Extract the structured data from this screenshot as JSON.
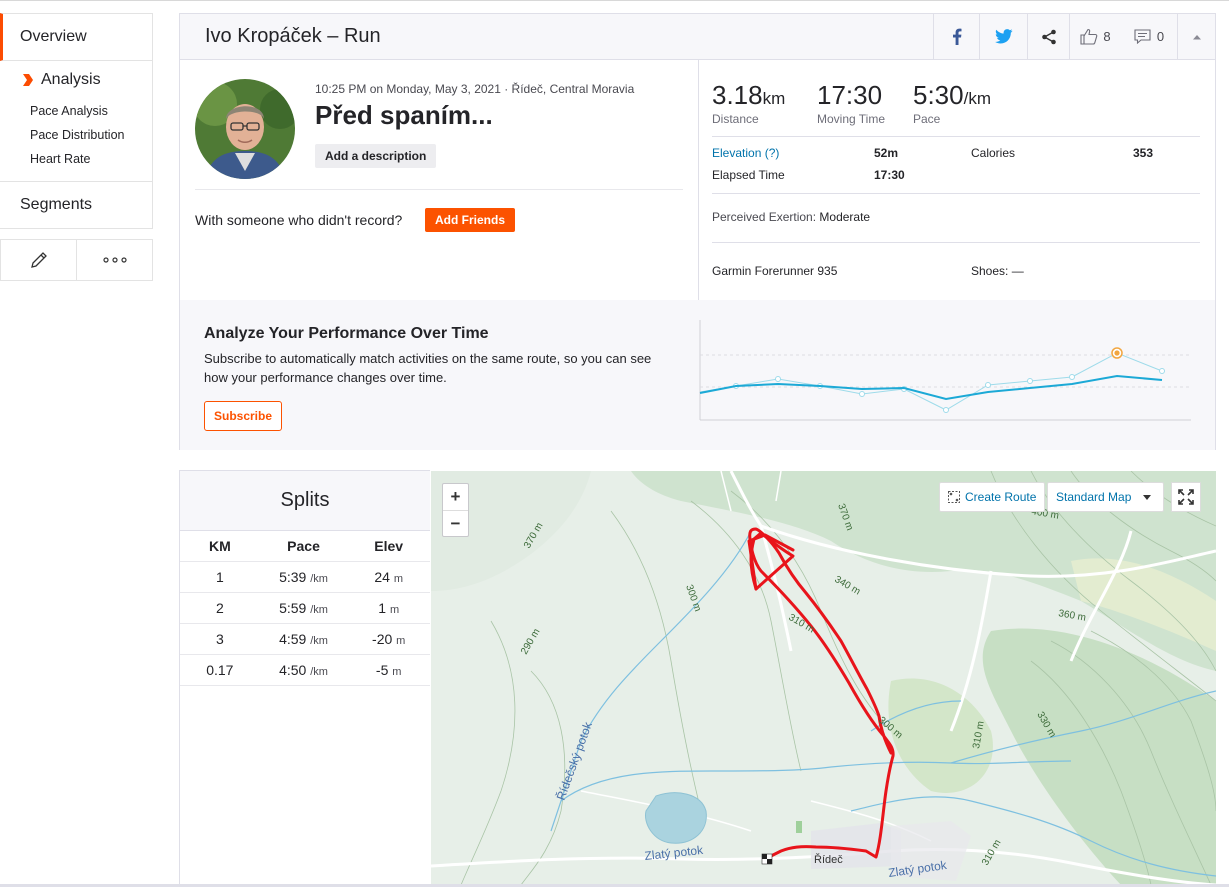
{
  "sidebar": {
    "overview": "Overview",
    "analysis": "Analysis",
    "analysis_items": [
      "Pace Analysis",
      "Pace Distribution",
      "Heart Rate"
    ],
    "segments": "Segments",
    "tools": [
      "pencil-icon",
      "more-icon"
    ]
  },
  "header": {
    "title": "Ivo Kropáček – Run",
    "kudos_count": "8",
    "comments_count": "0",
    "colors": {
      "facebook": "#3b5998",
      "twitter": "#1da1f2",
      "brand": "#fc4c02"
    }
  },
  "activity": {
    "meta": "10:25 PM on Monday, May 3, 2021 · Řídeč, Central Moravia",
    "name": "Před spaním...",
    "add_description": "Add a description",
    "with_someone": "With someone who didn't record?",
    "add_friends": "Add Friends"
  },
  "stats": {
    "distance": {
      "value": "3.18",
      "unit": "km",
      "label": "Distance"
    },
    "moving_time": {
      "value": "17:30",
      "label": "Moving Time"
    },
    "pace": {
      "value": "5:30",
      "unit": "/km",
      "label": "Pace"
    },
    "elevation_label": "Elevation (?)",
    "elevation_value": "52m",
    "calories_label": "Calories",
    "calories_value": "353",
    "elapsed_label": "Elapsed Time",
    "elapsed_value": "17:30",
    "exertion_label": "Perceived Exertion:",
    "exertion_value": "Moderate",
    "device": "Garmin Forerunner 935",
    "shoes": "Shoes: —"
  },
  "performance": {
    "title": "Analyze Your Performance Over Time",
    "text": "Subscribe to automatically match activities on the same route, so you can see how your performance changes over time.",
    "subscribe": "Subscribe"
  },
  "splits": {
    "title": "Splits",
    "headers": [
      "KM",
      "Pace",
      "Elev"
    ],
    "rows": [
      {
        "km": "1",
        "pace": "5:39",
        "pace_unit": "/km",
        "elev": "24",
        "elev_unit": "m"
      },
      {
        "km": "2",
        "pace": "5:59",
        "pace_unit": "/km",
        "elev": "1",
        "elev_unit": "m"
      },
      {
        "km": "3",
        "pace": "4:59",
        "pace_unit": "/km",
        "elev": "-20",
        "elev_unit": "m"
      },
      {
        "km": "0.17",
        "pace": "4:50",
        "pace_unit": "/km",
        "elev": "-5",
        "elev_unit": "m"
      }
    ]
  },
  "map": {
    "zoom_in": "+",
    "zoom_out": "−",
    "create_route": "Create Route",
    "map_type": "Standard Map",
    "labels": {
      "l370a": "370 m",
      "l370b": "370 m",
      "l400": "400 m",
      "l340": "340 m",
      "l300a": "300 m",
      "l310a": "310 m",
      "l360": "360 m",
      "l290": "290 m",
      "l300b": "300 m",
      "l330": "330 m",
      "l310b": "310 m",
      "l310c": "310 m",
      "stream1": "Řídečský potok",
      "stream2": "Zlatý potok",
      "stream3": "Zlatý potok",
      "village": "Řídeč"
    },
    "route_color": "#e8141b"
  }
}
